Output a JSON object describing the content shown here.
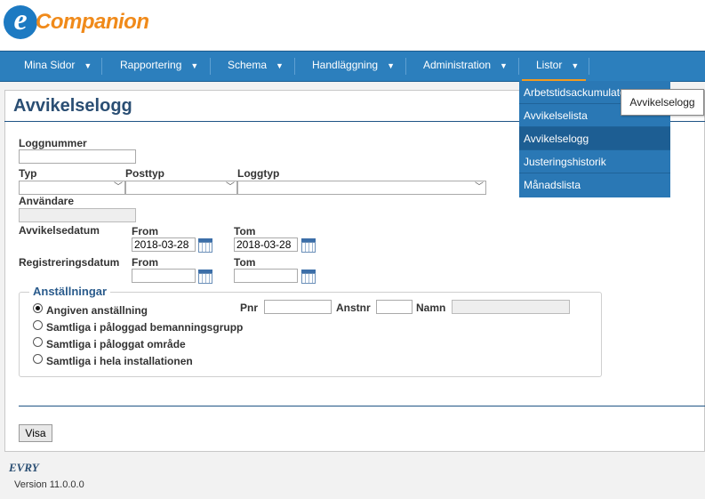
{
  "logo": {
    "letter": "e",
    "text": "Companion"
  },
  "nav": [
    {
      "label": "Mina Sidor"
    },
    {
      "label": "Rapportering"
    },
    {
      "label": "Schema"
    },
    {
      "label": "Handläggning"
    },
    {
      "label": "Administration"
    },
    {
      "label": "Listor"
    }
  ],
  "page": {
    "title": "Avvikelselogg"
  },
  "form": {
    "loggnummer_label": "Loggnummer",
    "loggnummer_value": "",
    "typ_label": "Typ",
    "posttyp_label": "Posttyp",
    "loggtyp_label": "Loggtyp",
    "anvandare_label": "Användare",
    "avvikelsedatum_label": "Avvikelsedatum",
    "registreringsdatum_label": "Registreringsdatum",
    "from_label": "From",
    "tom_label": "Tom",
    "avvikelse_from": "2018-03-28",
    "avvikelse_tom": "2018-03-28",
    "reg_from": "",
    "reg_tom": ""
  },
  "anstallningar": {
    "legend": "Anställningar",
    "options": [
      {
        "label": "Angiven anställning",
        "selected": true
      },
      {
        "label": "Samtliga i påloggad bemanningsgrupp",
        "selected": false
      },
      {
        "label": "Samtliga i påloggat område",
        "selected": false
      },
      {
        "label": "Samtliga i hela installationen",
        "selected": false
      }
    ],
    "pnr_label": "Pnr",
    "anstnr_label": "Anstnr",
    "namn_label": "Namn"
  },
  "buttons": {
    "visa": "Visa"
  },
  "footer": {
    "brand": "EVRY",
    "version": "Version 11.0.0.0"
  },
  "dropdown": {
    "items": [
      {
        "label": "Arbetstidsackumulator"
      },
      {
        "label": "Avvikelselista"
      },
      {
        "label": "Avvikelselogg"
      },
      {
        "label": "Justeringshistorik"
      },
      {
        "label": "Månadslista"
      }
    ],
    "tooltip": "Avvikelselogg"
  },
  "colors": {
    "nav": "#2c7fbd",
    "title": "#2a4e73",
    "accent": "#f39a1f",
    "logo_blue": "#1d7ac2",
    "logo_orange": "#f08a1a"
  },
  "icons": {
    "calendar": "calendar-icon",
    "caret": "caret-down-icon"
  }
}
